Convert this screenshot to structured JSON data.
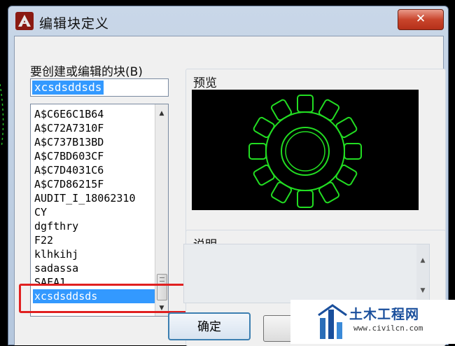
{
  "window": {
    "title": "编辑块定义",
    "close_symbol": "✕"
  },
  "block_name": {
    "label": "要创建或编辑的块(B)",
    "value": "xcsdsddsds"
  },
  "block_list": {
    "items": [
      "A$C6E6C1B64",
      "A$C72A7310F",
      "A$C737B13BD",
      "A$C7BD603CF",
      "A$C7D4031C6",
      "A$C7D86215F",
      "AUDIT_I_18062310",
      "CY",
      "dgfthry",
      "F22",
      "klhkihj",
      "sadassa",
      "SAFA1",
      "xcsdsddsds"
    ],
    "selected": "xcsdsddsds"
  },
  "preview": {
    "label": "预览"
  },
  "description": {
    "label": "说明",
    "value": ""
  },
  "buttons": {
    "ok": "确定"
  },
  "watermark": {
    "text": "土木工程网",
    "url": "www.civilcn.com"
  },
  "colors": {
    "selection": "#3399ff",
    "highlight_box": "#e02020",
    "preview_stroke": "#22dd22",
    "close": "#c9452c"
  }
}
